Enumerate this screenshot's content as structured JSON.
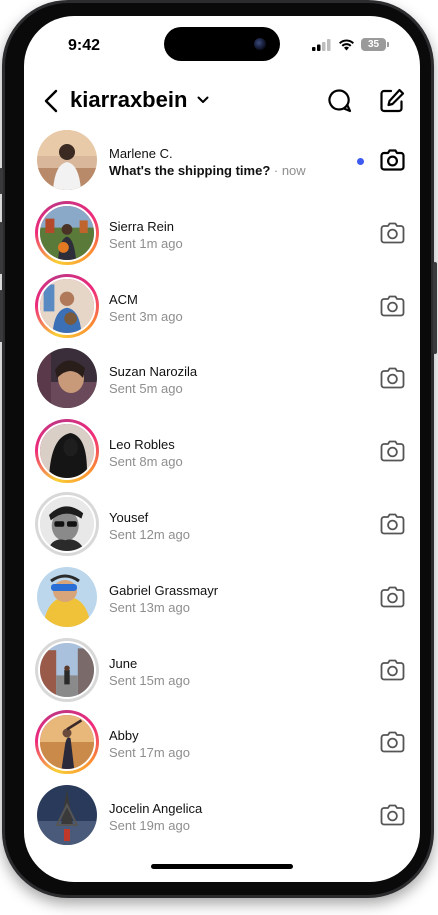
{
  "status_bar": {
    "time": "9:42",
    "battery": "35"
  },
  "header": {
    "username": "kiarraxbein"
  },
  "colors": {
    "unread_dot": "#3d5af1",
    "story_ring_start": "#f9ce34",
    "story_ring_mid": "#ee2a7b"
  },
  "icons": {
    "back": "chevron-left-icon",
    "dropdown": "chevron-down-icon",
    "search": "search-icon",
    "compose": "compose-icon",
    "camera": "camera-icon"
  },
  "messages": [
    {
      "name": "Marlene C.",
      "preview": "What's the shipping time?",
      "time": "now",
      "unread": true,
      "ring": "none"
    },
    {
      "name": "Sierra Rein",
      "status": "Sent 1m ago",
      "ring": "story"
    },
    {
      "name": "ACM",
      "status": "Sent 3m ago",
      "ring": "story"
    },
    {
      "name": "Suzan Narozila",
      "status": "Sent 5m ago",
      "ring": "none"
    },
    {
      "name": "Leo Robles",
      "status": "Sent 8m ago",
      "ring": "story"
    },
    {
      "name": "Yousef",
      "status": "Sent 12m ago",
      "ring": "seen"
    },
    {
      "name": "Gabriel Grassmayr",
      "status": "Sent 13m ago",
      "ring": "none"
    },
    {
      "name": "June",
      "status": "Sent 15m ago",
      "ring": "seen"
    },
    {
      "name": "Abby",
      "status": "Sent 17m ago",
      "ring": "story"
    },
    {
      "name": "Jocelin Angelica",
      "status": "Sent 19m ago",
      "ring": "none"
    }
  ]
}
